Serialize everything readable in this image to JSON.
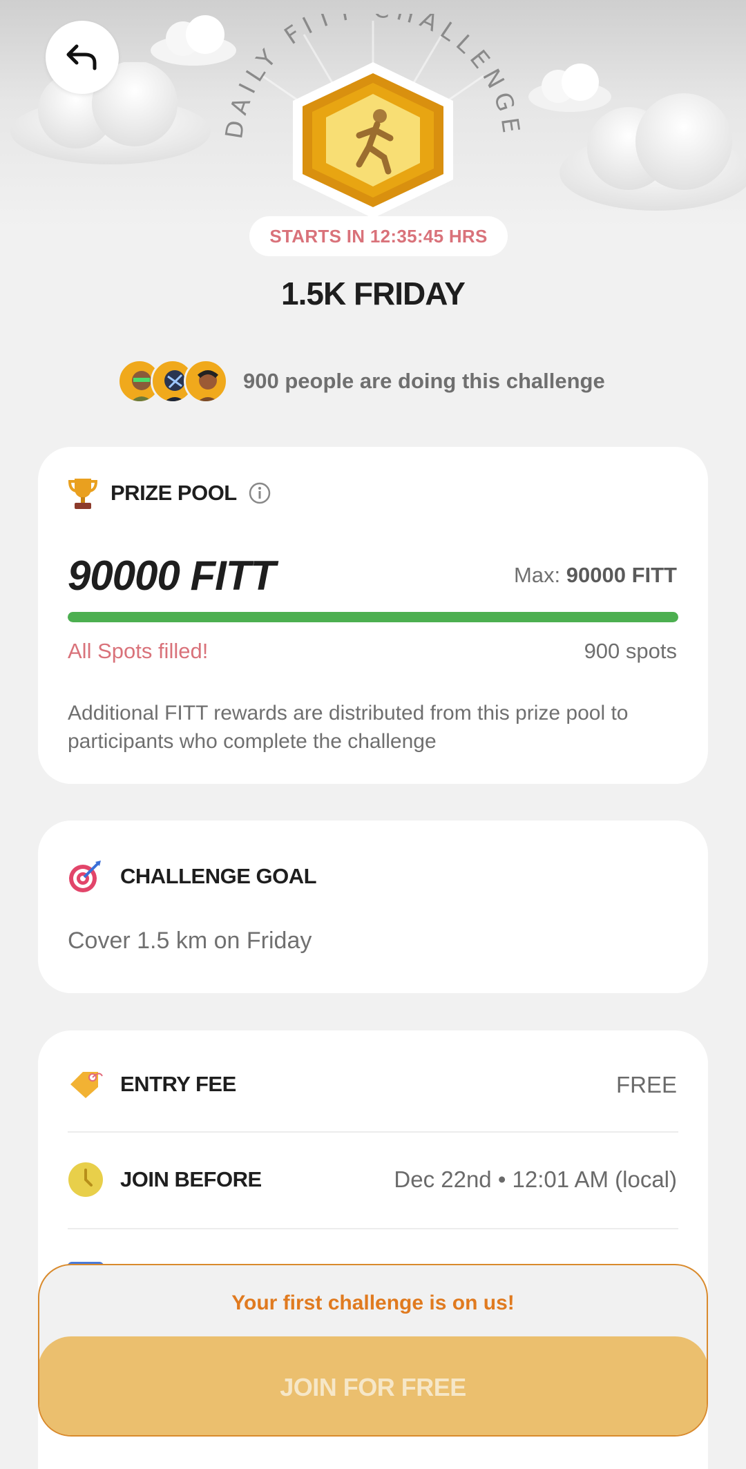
{
  "header": {
    "badge_arc_text": "DAILY FITT CHALLENGE",
    "starts_in": "STARTS IN 12:35:45 HRS"
  },
  "challenge": {
    "title": "1.5K FRIDAY",
    "participants_text": "900 people are doing this challenge"
  },
  "prize_pool": {
    "label": "PRIZE POOL",
    "amount": "90000 FITT",
    "max_label": "Max: ",
    "max_value": "90000 FITT",
    "progress_fraction": 1.0,
    "status": "All Spots filled!",
    "spots": "900 spots",
    "description": "Additional FITT rewards are distributed from this prize pool to participants who complete the challenge"
  },
  "goal": {
    "label": "CHALLENGE GOAL",
    "text": "Cover 1.5 km on Friday"
  },
  "details": {
    "entry_fee_label": "ENTRY FEE",
    "entry_fee_value": "FREE",
    "join_before_label": "JOIN BEFORE",
    "join_before_value": "Dec 22nd • 12:01 AM (local)"
  },
  "footer": {
    "promo": "Your first challenge is on us!",
    "join_button": "JOIN FOR FREE"
  },
  "colors": {
    "accent_orange": "#e07a1f",
    "progress_green": "#4caf50",
    "status_red": "#d9727a",
    "button_gold": "#ebbf6e"
  }
}
